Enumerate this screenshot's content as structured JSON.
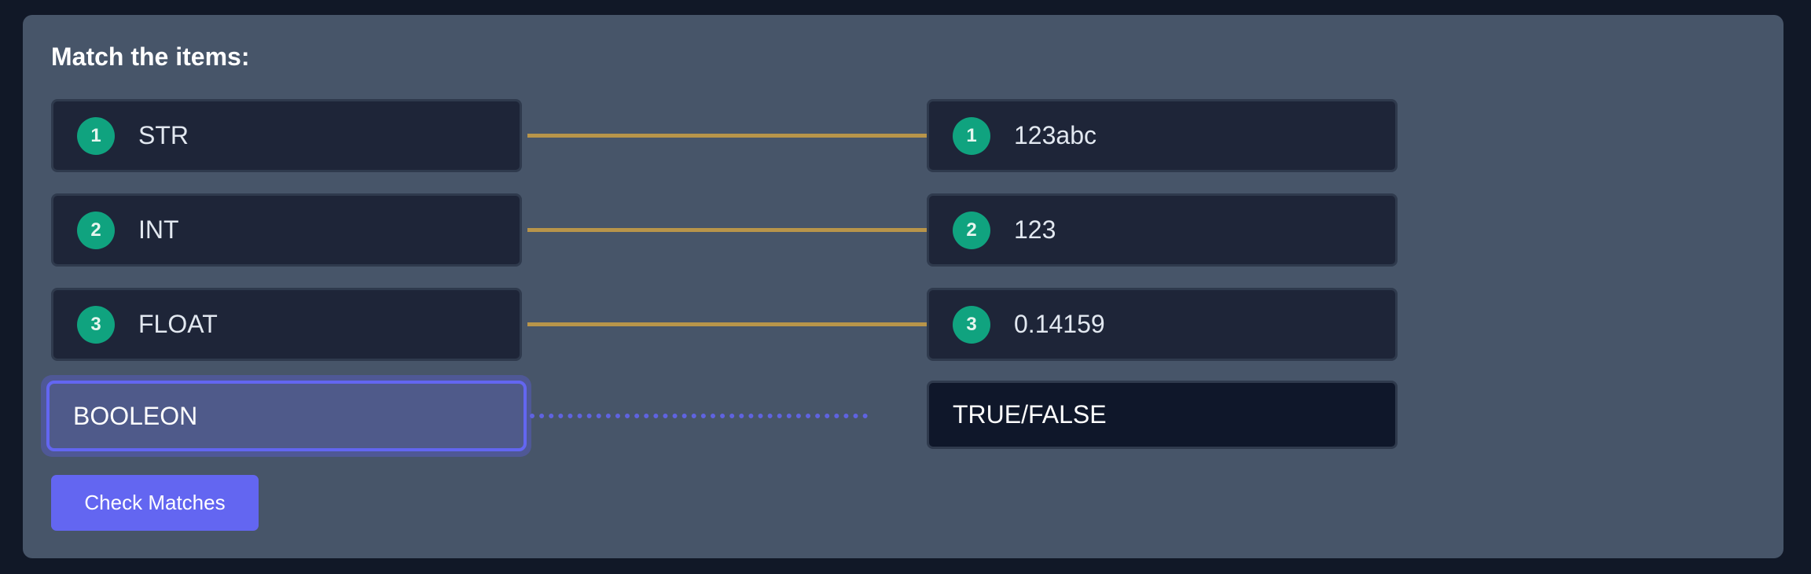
{
  "title": "Match the items:",
  "left_items": [
    {
      "number": "1",
      "label": "STR"
    },
    {
      "number": "2",
      "label": "INT"
    },
    {
      "number": "3",
      "label": "FLOAT"
    }
  ],
  "right_items": [
    {
      "number": "1",
      "label": "123abc"
    },
    {
      "number": "2",
      "label": "123"
    },
    {
      "number": "3",
      "label": "0.14159"
    }
  ],
  "active_item": {
    "label": "BOOLEON"
  },
  "target_item": {
    "label": "TRUE/FALSE"
  },
  "check_button": {
    "label": "Check Matches"
  },
  "colors": {
    "accent": "#6366f1",
    "badge": "#10a37f",
    "connector": "#b8954a",
    "panel": "#475569",
    "item_bg": "#1e2538"
  }
}
